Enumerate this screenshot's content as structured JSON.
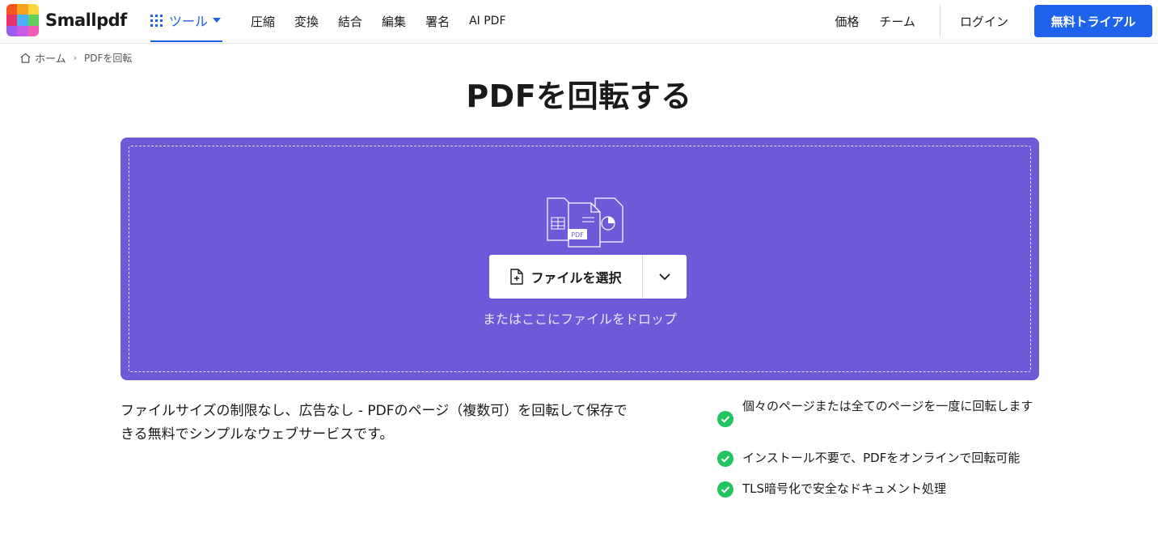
{
  "header": {
    "logo_text": "Smallpdf",
    "tools_label": "ツール",
    "nav": [
      "圧縮",
      "変換",
      "結合",
      "編集",
      "署名",
      "AI PDF"
    ],
    "pricing": "価格",
    "team": "チーム",
    "login": "ログイン",
    "trial": "無料トライアル"
  },
  "breadcrumb": {
    "home": "ホーム",
    "current": "PDFを回転"
  },
  "title": "PDFを回転する",
  "dropzone": {
    "select_label": "ファイルを選択",
    "drop_hint": "またはここにファイルをドロップ",
    "illustration_badge": "PDF"
  },
  "description": "ファイルサイズの制限なし、広告なし - PDFのページ（複数可）を回転して保存できる無料でシンプルなウェブサービスです。",
  "features": [
    "個々のページまたは全てのページを一度に回転します",
    "インストール不要で、PDFをオンラインで回転可能",
    "TLS暗号化で安全なドキュメント処理"
  ],
  "colors": {
    "accent": "#1f62ec",
    "dropzone": "#6e5ad9",
    "check": "#21c45d"
  }
}
